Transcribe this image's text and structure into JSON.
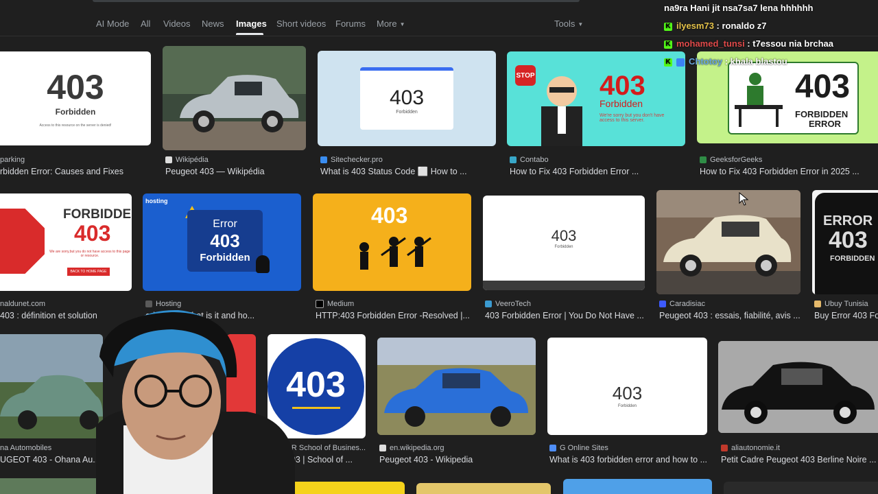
{
  "tabs": [
    "AI Mode",
    "All",
    "Videos",
    "News",
    "Images",
    "Short videos",
    "Forums",
    "More"
  ],
  "tools_label": "Tools",
  "results": [
    {
      "site": "parking",
      "title": "rbidden Error: Causes and Fixes",
      "thumb_code": "403",
      "thumb_caption": "Forbidden",
      "thumb_small": "Access to this resource on the server is denied!"
    },
    {
      "site": "Wikipédia",
      "title": "Peugeot 403 — Wikipédia"
    },
    {
      "site": "Sitechecker.pro",
      "title": "What is 403 Status Code  ⬜  How to ...",
      "thumb_code": "403",
      "thumb_caption": "Forbidden"
    },
    {
      "site": "Contabo",
      "title": "How to Fix 403 Forbidden Error ...",
      "thumb_code": "403",
      "thumb_caption": "Forbidden",
      "thumb_small": "We're sorry but you don't have access to this server.",
      "thumb_stop": "STOP"
    },
    {
      "site": "GeeksforGeeks",
      "title": "How to Fix 403 Forbidden Error in 2025 ...",
      "thumb_code": "403",
      "thumb_caption": "FORBIDDEN",
      "thumb_caption2": "ERROR"
    },
    {
      "site": "naldunet.com",
      "title": "403 : définition et solution",
      "thumb_word": "FORBIDDEN",
      "thumb_code": "403",
      "thumb_small": "We are sorry,but you do not have access to this page or resource.",
      "thumb_button": "BACK TO HOME PAGE"
    },
    {
      "site": "Hosting",
      "title": "orbidden: What is it and ho...",
      "thumb_brand": "hosting",
      "thumb_line1": "Error",
      "thumb_code": "403",
      "thumb_caption": "Forbidden"
    },
    {
      "site": "Medium",
      "title": "HTTP:403 Forbidden Error -Resolved |...",
      "thumb_code": "403"
    },
    {
      "site": "VeeroTech",
      "title": "403 Forbidden Error | You Do Not Have ...",
      "thumb_code": "403",
      "thumb_caption": "Forbidden"
    },
    {
      "site": "Caradisiac",
      "title": "Peugeot 403 : essais, fiabilité, avis ..."
    },
    {
      "site": "Ubuy Tunisia",
      "title": "Buy Error 403 Fo",
      "thumb_line1": "ERROR",
      "thumb_code": "403",
      "thumb_caption": "FORBIDDEN"
    },
    {
      "site": "na Automobiles",
      "title": "UGEOT 403 - Ohana Au..."
    },
    {
      "site": "UCR School of Busines...",
      "title": "rror 403 | School of ...",
      "thumb_code": "403"
    },
    {
      "site": "en.wikipedia.org",
      "title": "Peugeot 403 - Wikipedia"
    },
    {
      "site": "G Online Sites",
      "title": "What is 403 forbidden error and how to ...",
      "thumb_code": "403",
      "thumb_caption": "Forbidden"
    },
    {
      "site": "aliautonomie.it",
      "title": "Petit Cadre Peugeot 403 Berline Noire ..."
    }
  ],
  "chat": [
    {
      "user": "",
      "message": "na9ra Hani jit nsa7sa7 lena hhhhhh"
    },
    {
      "user": "ilyesm73",
      "message": " : ronaldo z7"
    },
    {
      "user": "mohamed_tunsi",
      "message": " : t7essou nia brchaa"
    },
    {
      "user": "Chtotoy",
      "message": " : khala blastou"
    }
  ],
  "colors": {
    "background": "#1f1f1f",
    "active_tab": "#ffffff",
    "inactive_tab": "#9aa0a6",
    "chat_badge": "#53fc18"
  }
}
